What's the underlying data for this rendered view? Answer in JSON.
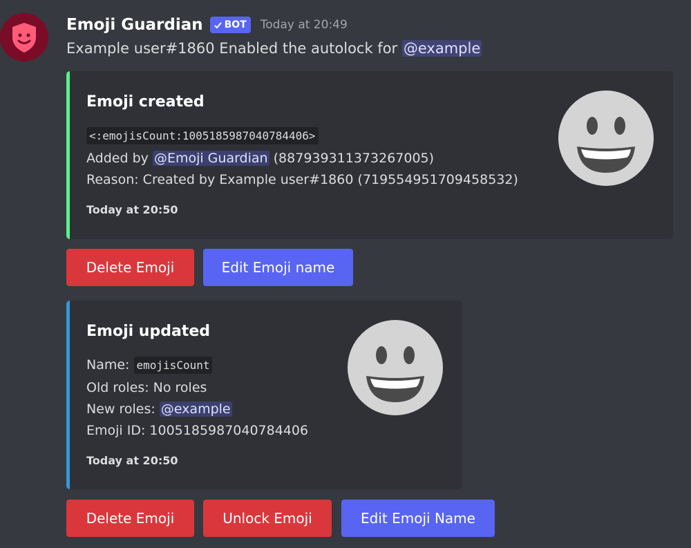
{
  "author": {
    "name": "Emoji Guardian",
    "bot_tag": "BOT",
    "timestamp": "Today at 20:49"
  },
  "message": {
    "prefix": "Example user#1860 Enabled the autolock for",
    "mention": "@example"
  },
  "embed_created": {
    "title": "Emoji created",
    "code": "<:emojisCount:1005185987040784406>",
    "added_by_label": "Added by",
    "added_by_mention": "@Emoji Guardian",
    "added_by_id": "(887939311373267005)",
    "reason": "Reason: Created by Example user#1860 (719554951709458532)",
    "footer": "Today at 20:50",
    "accent_color": "#57f287",
    "thumbnail": "grinning-emoji-icon"
  },
  "buttons_row1": {
    "delete": "Delete Emoji",
    "edit": "Edit Emoji name"
  },
  "embed_updated": {
    "title": "Emoji updated",
    "name_label": "Name:",
    "name_value": "emojisCount",
    "old_roles": "Old roles: No roles",
    "new_roles_label": "New roles:",
    "new_roles_mention": "@example",
    "emoji_id": "Emoji ID: 1005185987040784406",
    "footer": "Today at 20:50",
    "accent_color": "#3498db",
    "thumbnail": "grinning-emoji-icon"
  },
  "buttons_row2": {
    "delete": "Delete Emoji",
    "unlock": "Unlock Emoji",
    "edit": "Edit Emoji Name"
  }
}
